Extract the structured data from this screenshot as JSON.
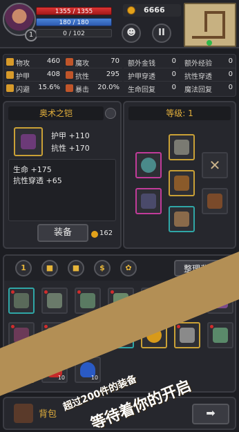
{
  "player": {
    "level": "1",
    "hp": "1355 / 1355",
    "mp": "180 / 180",
    "xp": "0 / 102",
    "gold": "6666"
  },
  "buttons": {
    "pause_icon": "II"
  },
  "stats": [
    {
      "label": "物攻",
      "value": "460",
      "icon": "sword-icon",
      "color": "#d79a2a"
    },
    {
      "label": "魔攻",
      "value": "70",
      "icon": "magic-icon",
      "color": "#c0552a"
    },
    {
      "label": "额外金钱",
      "value": "0",
      "icon": "",
      "color": ""
    },
    {
      "label": "额外经验",
      "value": "0",
      "icon": "",
      "color": ""
    },
    {
      "label": "护甲",
      "value": "408",
      "icon": "armor-icon",
      "color": "#d79a2a"
    },
    {
      "label": "抗性",
      "value": "295",
      "icon": "resist-icon",
      "color": "#c0552a"
    },
    {
      "label": "护甲穿透",
      "value": "0",
      "icon": "",
      "color": ""
    },
    {
      "label": "抗性穿透",
      "value": "0",
      "icon": "",
      "color": ""
    },
    {
      "label": "闪避",
      "value": "15.6%",
      "icon": "dodge-icon",
      "color": "#d79a2a"
    },
    {
      "label": "暴击",
      "value": "20.0%",
      "icon": "crit-icon",
      "color": "#c0552a"
    },
    {
      "label": "生命回复",
      "value": "0",
      "icon": "",
      "color": ""
    },
    {
      "label": "魔法回复",
      "value": "0",
      "icon": "",
      "color": ""
    }
  ],
  "item": {
    "name": "奥术之铠",
    "bonus1": "护甲 +110",
    "bonus2": "抗性 +170",
    "extra1": "生命 +175",
    "extra2": "抗性穿透 +65",
    "equip_label": "装备",
    "price": "162"
  },
  "equipment": {
    "level_label": "等级: 1"
  },
  "bag": {
    "filter_1": "1",
    "filter_money": "$",
    "sort_label": "整理背包",
    "potion_count": "10",
    "bottom_label": "背包"
  },
  "promo": {
    "line1": "超过200件的装备",
    "line2": "等待着你的开启"
  },
  "colors": {
    "gold": "#e4b03c",
    "hp": "#c82a2a",
    "mp": "#3a70c8",
    "banner": "#b38f55"
  }
}
